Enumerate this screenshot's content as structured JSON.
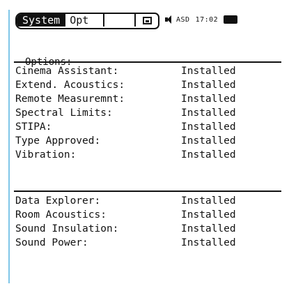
{
  "status_bar": {
    "tabs": [
      {
        "label": "System",
        "active": true
      },
      {
        "label": "Opt",
        "active": false
      },
      {
        "label": "",
        "active": false
      }
    ],
    "drive_icon": "memory-card-icon",
    "speaker_icon": "speaker-icon",
    "code": "ASD",
    "time": "17:02",
    "battery_icon": "battery-icon"
  },
  "options": {
    "title": "Options:",
    "group1": [
      {
        "label": "Cinema Assistant:",
        "value": "Installed"
      },
      {
        "label": "Extend. Acoustics:",
        "value": "Installed"
      },
      {
        "label": "Remote Measuremnt:",
        "value": "Installed"
      },
      {
        "label": "Spectral Limits:",
        "value": "Installed"
      },
      {
        "label": "STIPA:",
        "value": "Installed"
      },
      {
        "label": "Type Approved:",
        "value": "Installed"
      },
      {
        "label": "Vibration:",
        "value": "Installed"
      }
    ],
    "group2": [
      {
        "label": "Data Explorer:",
        "value": "Installed"
      },
      {
        "label": "Room Acoustics:",
        "value": "Installed"
      },
      {
        "label": "Sound Insulation:",
        "value": "Installed"
      },
      {
        "label": "Sound Power:",
        "value": "Installed"
      }
    ]
  },
  "colors": {
    "foreground": "#111111",
    "background": "#ffffff",
    "frame_accent": "#7fc6e8"
  }
}
